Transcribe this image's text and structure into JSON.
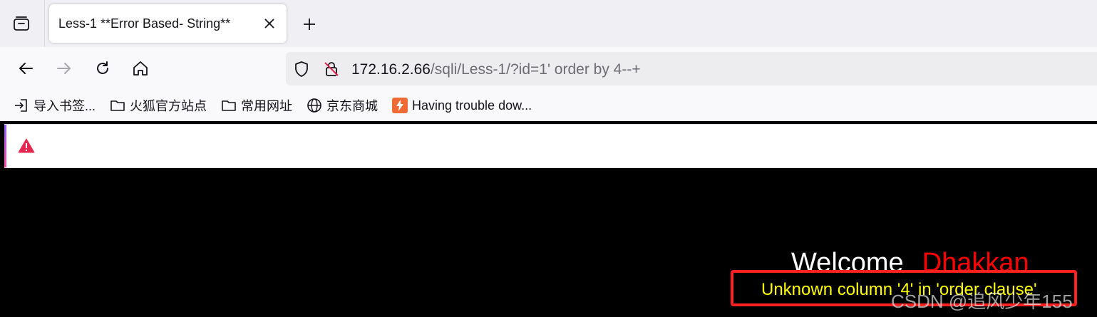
{
  "tab": {
    "title": "Less-1 **Error Based- String**"
  },
  "urlbar": {
    "host": "172.16.2.66",
    "path": "/sqli/Less-1/?id=1' order by 4--+"
  },
  "bookmarks": [
    {
      "label": "导入书签...",
      "icon": "import-icon"
    },
    {
      "label": "火狐官方站点",
      "icon": "folder-icon"
    },
    {
      "label": "常用网址",
      "icon": "folder-icon"
    },
    {
      "label": "京东商城",
      "icon": "globe-icon"
    },
    {
      "label": "Having trouble dow...",
      "icon": "bolt-icon"
    }
  ],
  "page": {
    "welcome": "Welcome",
    "name": "Dhakkan",
    "error": "Unknown column '4' in 'order clause'",
    "watermark": "CSDN @追风少年155"
  },
  "colors": {
    "welcome_name": "#ff0000",
    "error_text": "#ffff00",
    "highlight_box": "#ff2020",
    "warning_icon": "#e22850"
  }
}
